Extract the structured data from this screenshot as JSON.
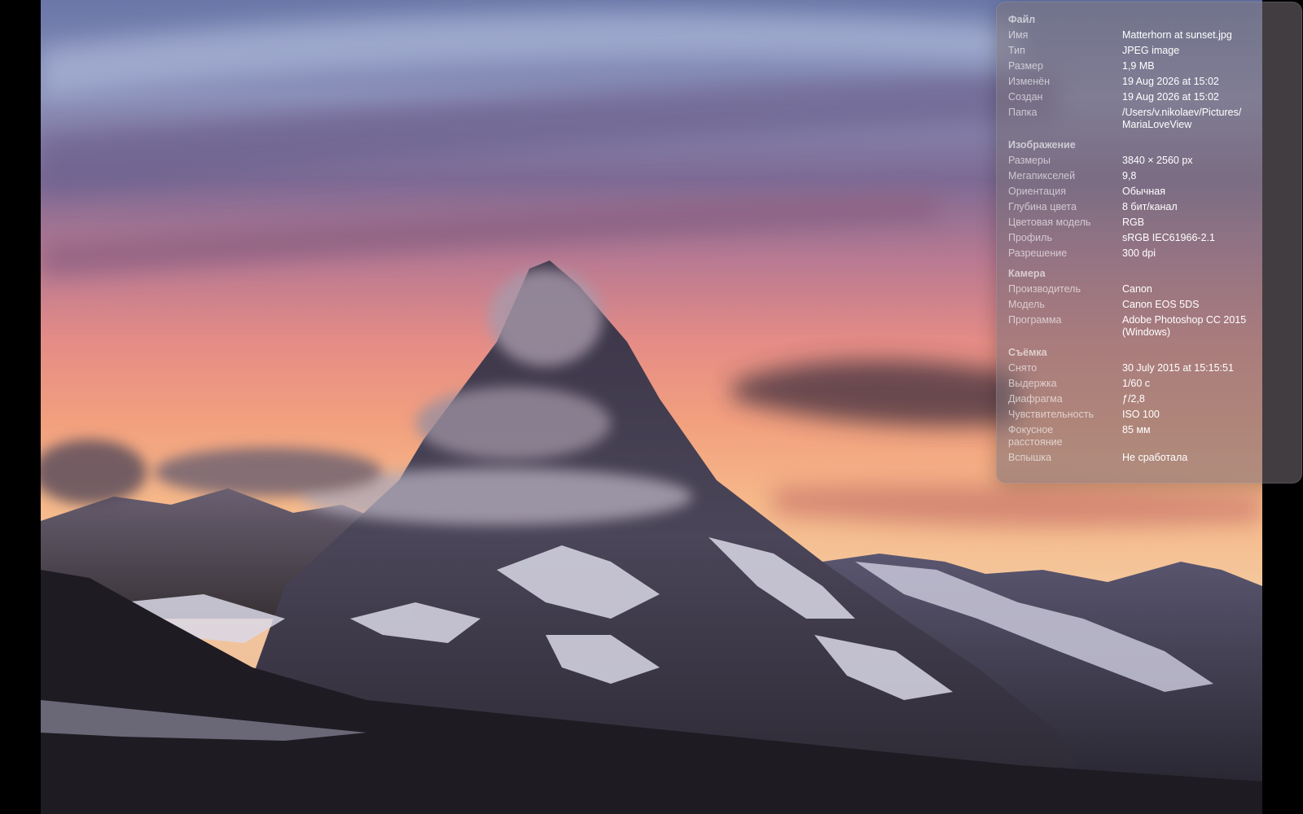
{
  "photo": {
    "alt": "Matterhorn at sunset"
  },
  "info_panel": {
    "sections": [
      {
        "title": "Файл",
        "rows": [
          {
            "label": "Имя",
            "value": "Matterhorn at sunset.jpg"
          },
          {
            "label": "Тип",
            "value": "JPEG image"
          },
          {
            "label": "Размер",
            "value": "1,9 MB"
          },
          {
            "label": "Изменён",
            "value": "19 Aug 2026 at 15:02"
          },
          {
            "label": "Создан",
            "value": "19 Aug 2026 at 15:02"
          },
          {
            "label": "Папка",
            "value": "/Users/v.nikolaev/Pictures/\nMariaLoveView"
          }
        ]
      },
      {
        "title": "Изображение",
        "rows": [
          {
            "label": "Размеры",
            "value": "3840 × 2560 px"
          },
          {
            "label": "Мегапикселей",
            "value": "9,8"
          },
          {
            "label": "Ориентация",
            "value": "Обычная"
          },
          {
            "label": "Глубина цвета",
            "value": "8 бит/канал"
          },
          {
            "label": "Цветовая модель",
            "value": "RGB"
          },
          {
            "label": "Профиль",
            "value": "sRGB IEC61966-2.1"
          },
          {
            "label": "Разрешение",
            "value": "300 dpi"
          }
        ]
      },
      {
        "title": "Камера",
        "rows": [
          {
            "label": "Производитель",
            "value": "Canon"
          },
          {
            "label": "Модель",
            "value": "Canon EOS 5DS"
          },
          {
            "label": "Программа",
            "value": "Adobe Photoshop CC 2015\n(Windows)"
          }
        ]
      },
      {
        "title": "Съёмка",
        "rows": [
          {
            "label": "Снято",
            "value": "30 July 2015 at 15:15:51"
          },
          {
            "label": "Выдержка",
            "value": "1/60 c"
          },
          {
            "label": "Диафрагма",
            "value": "ƒ/2,8"
          },
          {
            "label": "Чувствительность",
            "value": "ISO 100"
          },
          {
            "label": "Фокусное\nрасстояние",
            "value": "85 мм"
          },
          {
            "label": "Вспышка",
            "value": "Не сработала"
          }
        ]
      }
    ]
  }
}
